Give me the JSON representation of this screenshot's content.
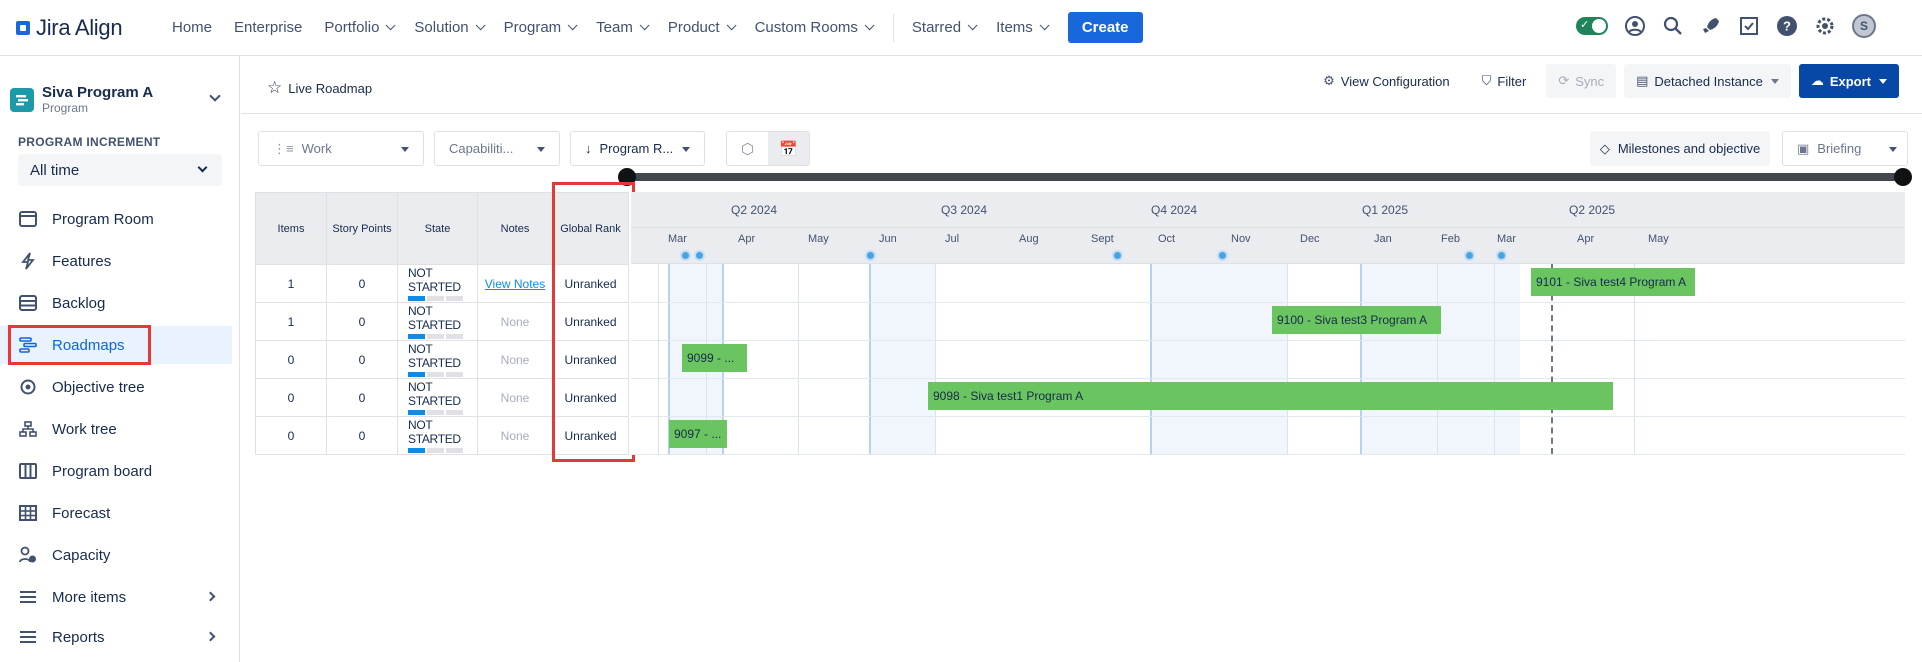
{
  "app": {
    "logo_text": "Jira Align"
  },
  "nav": {
    "items": [
      {
        "label": "Home",
        "has_menu": false
      },
      {
        "label": "Enterprise",
        "has_menu": false
      },
      {
        "label": "Portfolio",
        "has_menu": true
      },
      {
        "label": "Solution",
        "has_menu": true
      },
      {
        "label": "Program",
        "has_menu": true
      },
      {
        "label": "Team",
        "has_menu": true
      },
      {
        "label": "Product",
        "has_menu": true
      },
      {
        "label": "Custom Rooms",
        "has_menu": true
      }
    ],
    "right_items": [
      {
        "label": "Starred"
      },
      {
        "label": "Items"
      }
    ],
    "create_label": "Create",
    "avatar_initial": "S"
  },
  "sidebar": {
    "program_name": "Siva Program A",
    "program_type": "Program",
    "pi_label": "PROGRAM INCREMENT",
    "pi_value": "All time",
    "items": [
      {
        "label": "Program Room",
        "icon": "program-room-icon"
      },
      {
        "label": "Features",
        "icon": "features-icon"
      },
      {
        "label": "Backlog",
        "icon": "backlog-icon"
      },
      {
        "label": "Roadmaps",
        "icon": "roadmaps-icon",
        "active": true
      },
      {
        "label": "Objective tree",
        "icon": "objective-tree-icon"
      },
      {
        "label": "Work tree",
        "icon": "work-tree-icon"
      },
      {
        "label": "Program board",
        "icon": "program-board-icon"
      },
      {
        "label": "Forecast",
        "icon": "forecast-icon"
      },
      {
        "label": "Capacity",
        "icon": "capacity-icon"
      }
    ],
    "more_items_label": "More items",
    "reports_label": "Reports"
  },
  "header": {
    "title": "Live Roadmap",
    "view_config_label": "View Configuration",
    "filter_label": "Filter",
    "sync_label": "Sync",
    "detached_label": "Detached Instance",
    "export_label": "Export"
  },
  "toolbar": {
    "work_label": "Work",
    "capabilities_label": "Capabiliti...",
    "program_rank_label": "Program R...",
    "milestones_label": "Milestones and objective",
    "briefing_label": "Briefing"
  },
  "table": {
    "headers": [
      "Items",
      "Story Points",
      "State",
      "Notes",
      "Global Rank"
    ],
    "rows": [
      {
        "items": "1",
        "points": "0",
        "state": "NOT STARTED",
        "notes": "View Notes",
        "notes_link": true,
        "rank": "Unranked"
      },
      {
        "items": "1",
        "points": "0",
        "state": "NOT STARTED",
        "notes": "None",
        "notes_link": false,
        "rank": "Unranked"
      },
      {
        "items": "0",
        "points": "0",
        "state": "NOT STARTED",
        "notes": "None",
        "notes_link": false,
        "rank": "Unranked"
      },
      {
        "items": "0",
        "points": "0",
        "state": "NOT STARTED",
        "notes": "None",
        "notes_link": false,
        "rank": "Unranked"
      },
      {
        "items": "0",
        "points": "0",
        "state": "NOT STARTED",
        "notes": "None",
        "notes_link": false,
        "rank": "Unranked"
      }
    ]
  },
  "gantt": {
    "quarters": [
      "Q2 2024",
      "Q3 2024",
      "Q4 2024",
      "Q1 2025",
      "Q2 2025"
    ],
    "months": [
      "Mar",
      "Apr",
      "May",
      "Jun",
      "Jul",
      "Aug",
      "Sept",
      "Oct",
      "Nov",
      "Dec",
      "Jan",
      "Feb",
      "Mar",
      "Apr",
      "May"
    ],
    "bars": [
      {
        "row": 0,
        "label": "9101 - Siva test4 Program A"
      },
      {
        "row": 1,
        "label": "9100 - Siva test3 Program A"
      },
      {
        "row": 2,
        "label": "9099 - ..."
      },
      {
        "row": 3,
        "label": "9098 - Siva test1 Program A"
      },
      {
        "row": 4,
        "label": "9097 - ..."
      }
    ],
    "bar_color": "#6ac45f",
    "milestone_color": "#4aa3df"
  }
}
